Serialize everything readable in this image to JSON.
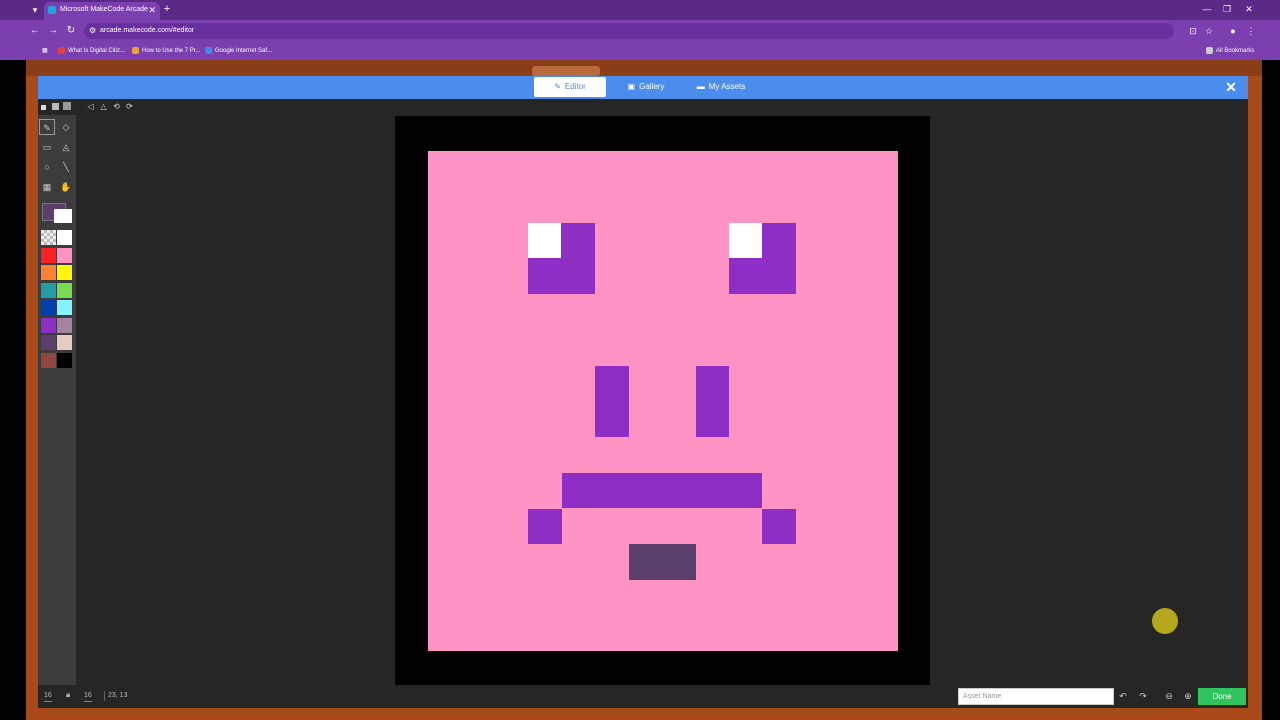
{
  "browser": {
    "tab_title": "Microsoft MakeCode Arcade",
    "url": "arcade.makecode.com/#editor",
    "bookmarks": [
      {
        "label": "What Is Digital Citiz..."
      },
      {
        "label": "How to Use the 7 Pr..."
      },
      {
        "label": "Google Internet Saf..."
      }
    ],
    "all_bookmarks": "All Bookmarks"
  },
  "editor": {
    "tabs": [
      {
        "label": "Editor",
        "icon": "pencil-icon",
        "active": true
      },
      {
        "label": "Gallery",
        "icon": "image-icon",
        "active": false
      },
      {
        "label": "My Assets",
        "icon": "folder-icon",
        "active": false
      }
    ],
    "close_symbol": "✕",
    "canvas_width": "16",
    "canvas_height": "16",
    "cursor_position": "23, 13",
    "asset_name_placeholder": "Asset Name",
    "done_label": "Done",
    "primary_color": "#5c3d6b",
    "secondary_color": "#ffffff"
  },
  "palette": [
    "transparent",
    "#ffffff",
    "#ff2121",
    "#ff93c4",
    "#ff8135",
    "#fff609",
    "#249ca3",
    "#78dc52",
    "#003fad",
    "#87f2ff",
    "#8e2ec4",
    "#a4839f",
    "#5c406c",
    "#e5cdc4",
    "#91463d",
    "#000000"
  ],
  "sprite": {
    "background": "#ff93c4",
    "colors": {
      "purple": "#8e2ec4",
      "white": "#ffffff",
      "mauve": "#5c406c"
    }
  }
}
